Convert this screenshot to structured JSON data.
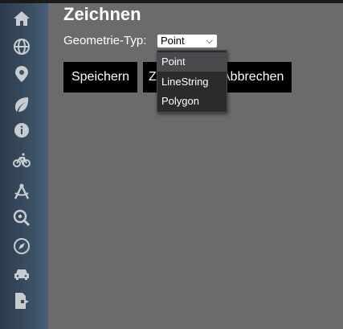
{
  "page": {
    "title": "Zeichnen"
  },
  "form": {
    "geometry_label": "Geometrie-Typ:",
    "selected_value": "Point",
    "options": [
      "Point",
      "LineString",
      "Polygon"
    ]
  },
  "buttons": {
    "save_label": "Speichern",
    "back_label": "Zurück",
    "cancel_label": "Abbrechen"
  },
  "sidebar": {
    "icons": [
      "home-icon",
      "globe-icon",
      "map-marker-icon",
      "leaf-icon",
      "info-icon",
      "bicycle-icon",
      "compass-drafting-icon",
      "search-location-icon",
      "compass-icon",
      "car-icon",
      "file-export-icon"
    ]
  },
  "colors": {
    "background": "#6b6b6b",
    "sidebar": "#3d5266",
    "button": "#000000",
    "dropdown": "#2b2b2b",
    "dropdown_selected": "#4a4a4e",
    "icon": "#c8ccd0"
  }
}
